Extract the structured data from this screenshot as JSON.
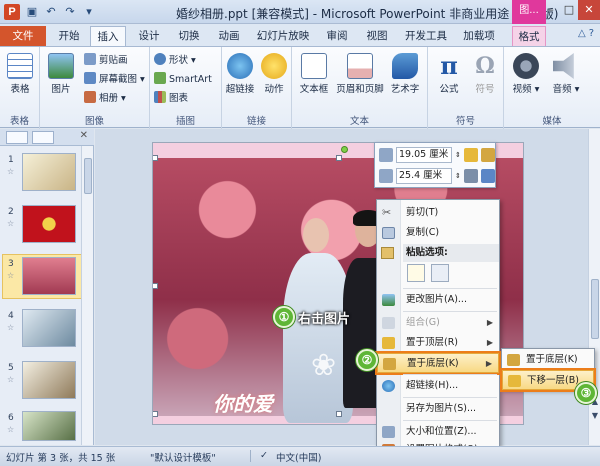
{
  "window": {
    "title": "婚纱相册.ppt [兼容模式] - Microsoft PowerPoint 非商业用途 (试用版)",
    "context_tab_header": "图..."
  },
  "ribbon": {
    "tabs": [
      "文件",
      "开始",
      "插入",
      "设计",
      "切换",
      "动画",
      "幻灯片放映",
      "审阅",
      "视图",
      "开发工具",
      "加载项",
      "格式"
    ],
    "active_tab": "插入",
    "groups": {
      "tables": {
        "label": "表格",
        "table_btn": "表格"
      },
      "images": {
        "label": "图像",
        "picture_btn": "图片",
        "clipart": "剪贴画",
        "screenshot": "屏幕截图",
        "album": "相册"
      },
      "illustrations": {
        "label": "插图",
        "shapes": "形状",
        "smartart": "SmartArt",
        "chart": "图表"
      },
      "links": {
        "label": "链接",
        "hyperlink": "超链接",
        "action": "动作"
      },
      "text": {
        "label": "文本",
        "textbox": "文本框",
        "header_footer": "页眉和页脚",
        "wordart": "艺术字"
      },
      "symbols": {
        "label": "符号",
        "equation": "公式",
        "symbol": "符号"
      },
      "media": {
        "label": "媒体",
        "video": "视频",
        "audio": "音频"
      }
    }
  },
  "thumbnails": {
    "slides": [
      {
        "num": "1"
      },
      {
        "num": "2"
      },
      {
        "num": "3"
      },
      {
        "num": "4"
      },
      {
        "num": "5"
      },
      {
        "num": "6"
      }
    ],
    "selected": "3"
  },
  "slide": {
    "caption": "你的爱"
  },
  "minibar": {
    "height_value": "19.05 厘米",
    "width_value": "25.4 厘米"
  },
  "context_menu": {
    "cut": "剪切(T)",
    "copy": "复制(C)",
    "paste_header": "粘贴选项:",
    "change_picture": "更改图片(A)...",
    "group": "组合(G)",
    "bring_front": "置于顶层(R)",
    "send_back": "置于底层(K)",
    "hyperlink": "超链接(H)...",
    "save_as_picture": "另存为图片(S)...",
    "size_position": "大小和位置(Z)...",
    "format_picture": "设置图片格式(O)..."
  },
  "submenu": {
    "send_to_back": "置于底层(K)",
    "send_backward": "下移一层(B)"
  },
  "callouts": {
    "step1": "①",
    "step1_text": "右击图片",
    "step2": "②",
    "step3": "③"
  },
  "statusbar": {
    "slide_info": "幻灯片 第 3 张，共 15 张",
    "theme": "\"默认设计模板\"",
    "language": "中文(中国)"
  },
  "colors": {
    "file_tab": "#d4552c",
    "format_tab": "#e0389c",
    "highlight": "#ec7d1a",
    "callout_green": "#5fb636"
  }
}
